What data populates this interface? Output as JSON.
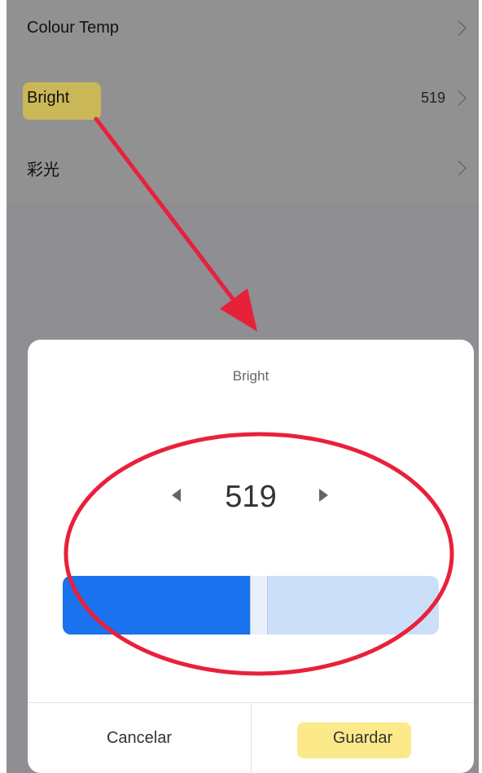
{
  "settings_list": {
    "items": [
      {
        "label": "Colour Temp",
        "value": ""
      },
      {
        "label": "Bright",
        "value": "519"
      },
      {
        "label": "彩光",
        "value": ""
      }
    ]
  },
  "modal": {
    "title": "Bright",
    "value": "519",
    "slider_fraction": 0.5,
    "buttons": {
      "cancel": "Cancelar",
      "save": "Guardar"
    }
  },
  "colors": {
    "accent": "#1b72ee",
    "track": "#ccdff9",
    "annotation_red": "#e8213b",
    "highlight_yellow": "#fad728"
  },
  "icons": [
    "chevron-right-icon",
    "decrement-arrow-icon",
    "increment-arrow-icon"
  ]
}
